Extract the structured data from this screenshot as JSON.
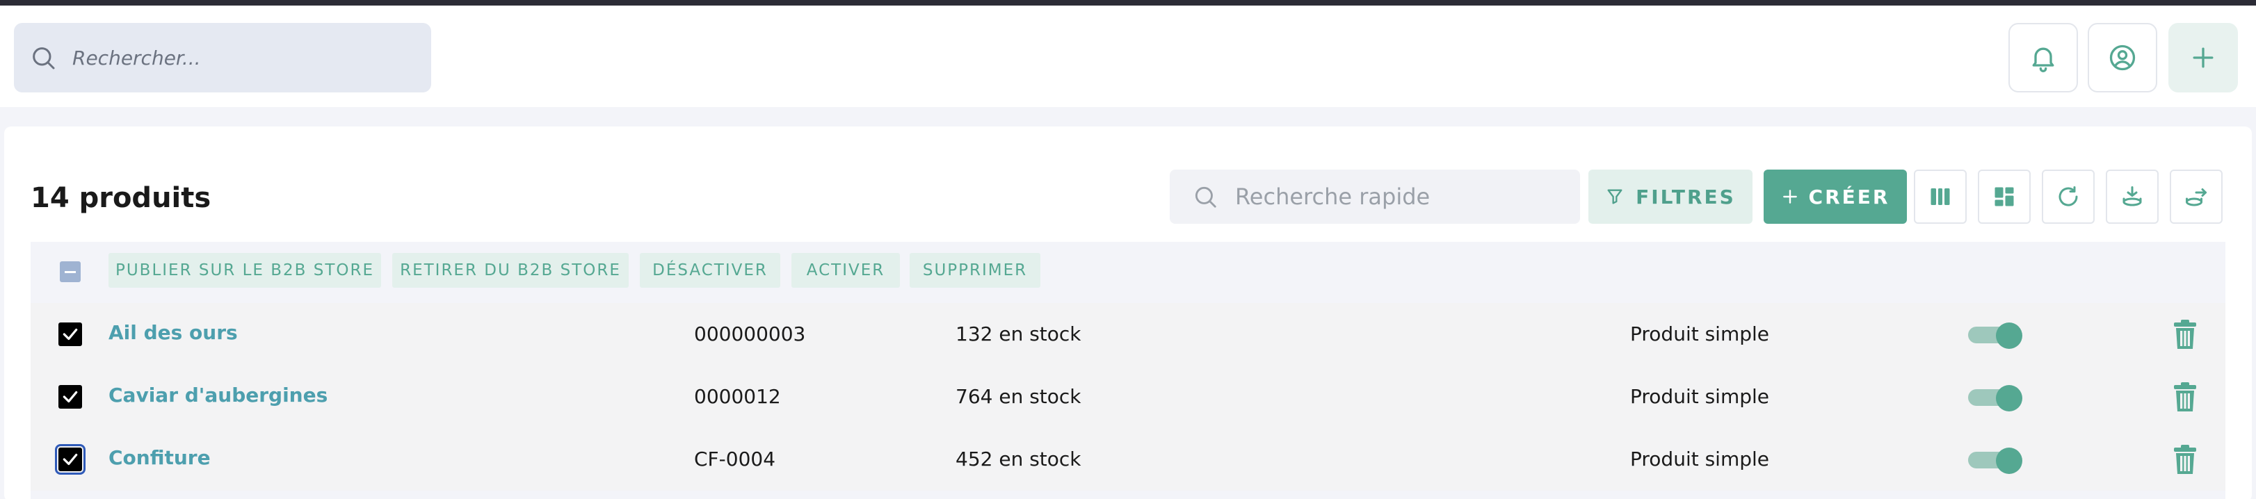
{
  "header": {
    "search_placeholder": "Rechercher...",
    "icons": [
      "bell-icon",
      "user-circle-icon",
      "plus-icon"
    ]
  },
  "products": {
    "title": "14 produits",
    "quick_search_placeholder": "Recherche rapide",
    "filters_label": "FILTRES",
    "create_label": "CRÉER",
    "toolbar_icons": [
      "columns-icon",
      "layout-icon",
      "refresh-icon",
      "import-icon",
      "export-icon"
    ]
  },
  "bulk_actions": [
    "PUBLIER SUR LE B2B STORE",
    "RETIRER DU B2B STORE",
    "DÉSACTIVER",
    "ACTIVER",
    "SUPPRIMER"
  ],
  "rows": [
    {
      "name": "Ail des ours",
      "sku": "000000003",
      "stock": "132 en stock",
      "type": "Produit simple",
      "active": true,
      "checked": true
    },
    {
      "name": "Caviar d'aubergines",
      "sku": "0000012",
      "stock": "764 en stock",
      "type": "Produit simple",
      "active": true,
      "checked": true
    },
    {
      "name": "Confiture",
      "sku": "CF-0004",
      "stock": "452 en stock",
      "type": "Produit simple",
      "active": true,
      "checked": true
    }
  ],
  "colors": {
    "accent": "#55a892",
    "link": "#4d9fae",
    "accent_light": "#e3f0ec"
  }
}
